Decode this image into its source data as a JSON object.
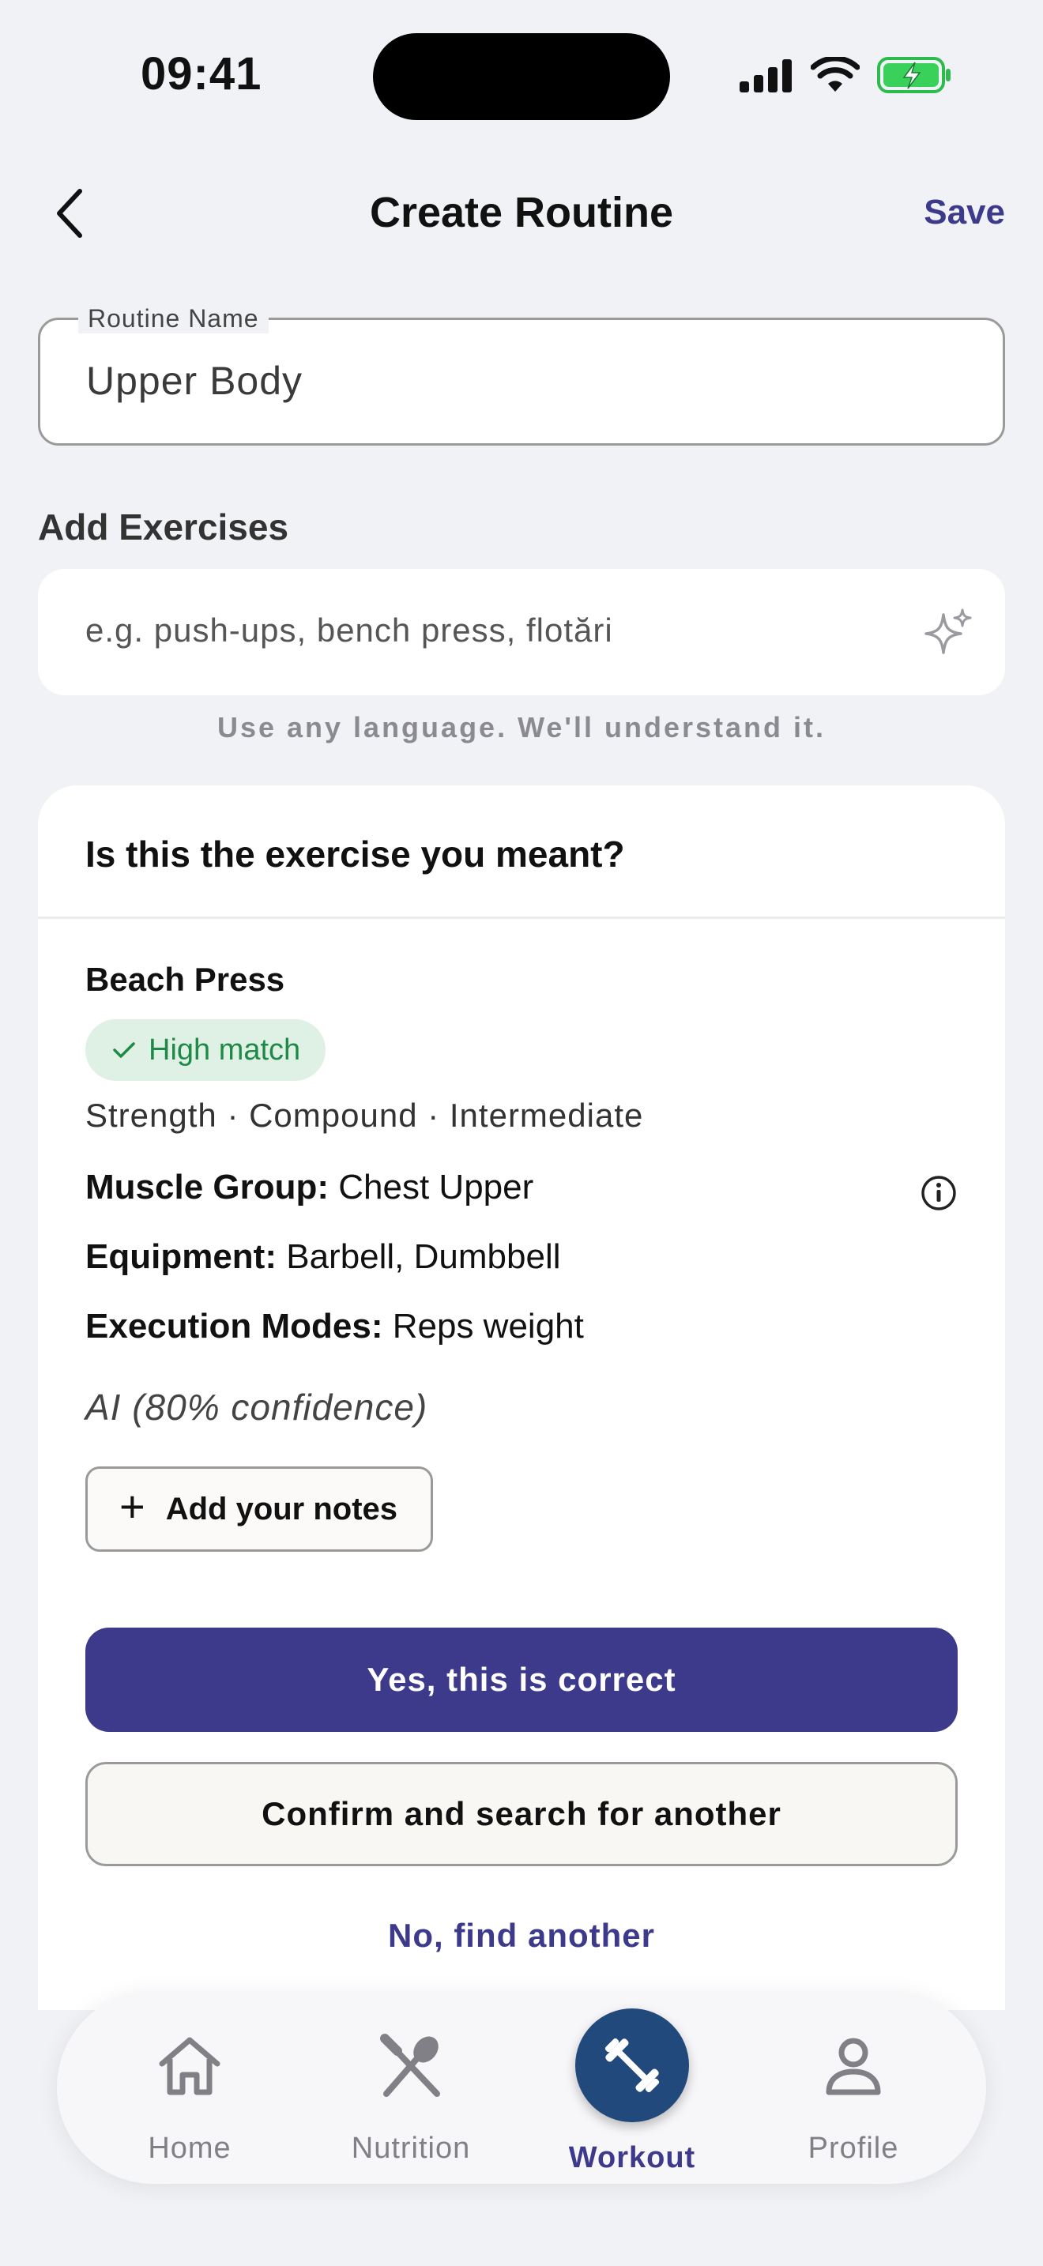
{
  "status_bar": {
    "time": "09:41"
  },
  "nav": {
    "title": "Create Routine",
    "save_label": "Save"
  },
  "routine_field": {
    "label": "Routine Name",
    "value": "Upper Body"
  },
  "add_exercises": {
    "title": "Add Exercises",
    "placeholder": "e.g. push-ups, bench press, flotări",
    "hint": "Use any language. We'll understand it."
  },
  "suggestion_card": {
    "question": "Is this the exercise you meant?",
    "exercise_name": "Beach Press",
    "match_badge": "High match",
    "meta": "Strength · Compound · Intermediate",
    "muscle_group_label": "Muscle Group:",
    "muscle_group_value": "Chest Upper",
    "equipment_label": "Equipment:",
    "equipment_value": "Barbell, Dumbbell",
    "execution_label": "Execution Modes:",
    "execution_value": "Reps weight",
    "ai_confidence": "AI (80% confidence)",
    "notes_button": "Add your notes",
    "primary_button": "Yes, this is correct",
    "secondary_button": "Confirm and search for another",
    "link_button": "No, find another"
  },
  "tabbar": {
    "tabs": [
      {
        "label": "Home",
        "icon": "home-icon"
      },
      {
        "label": "Nutrition",
        "icon": "nutrition-icon"
      },
      {
        "label": "Workout",
        "icon": "dumbbell-icon",
        "active": true
      },
      {
        "label": "Profile",
        "icon": "profile-icon"
      }
    ]
  },
  "colors": {
    "accent": "#3d3a8c",
    "workout_active": "#22497c",
    "match_bg": "#dff1e5",
    "match_text": "#1f8a47",
    "background": "#f1f2f6"
  }
}
